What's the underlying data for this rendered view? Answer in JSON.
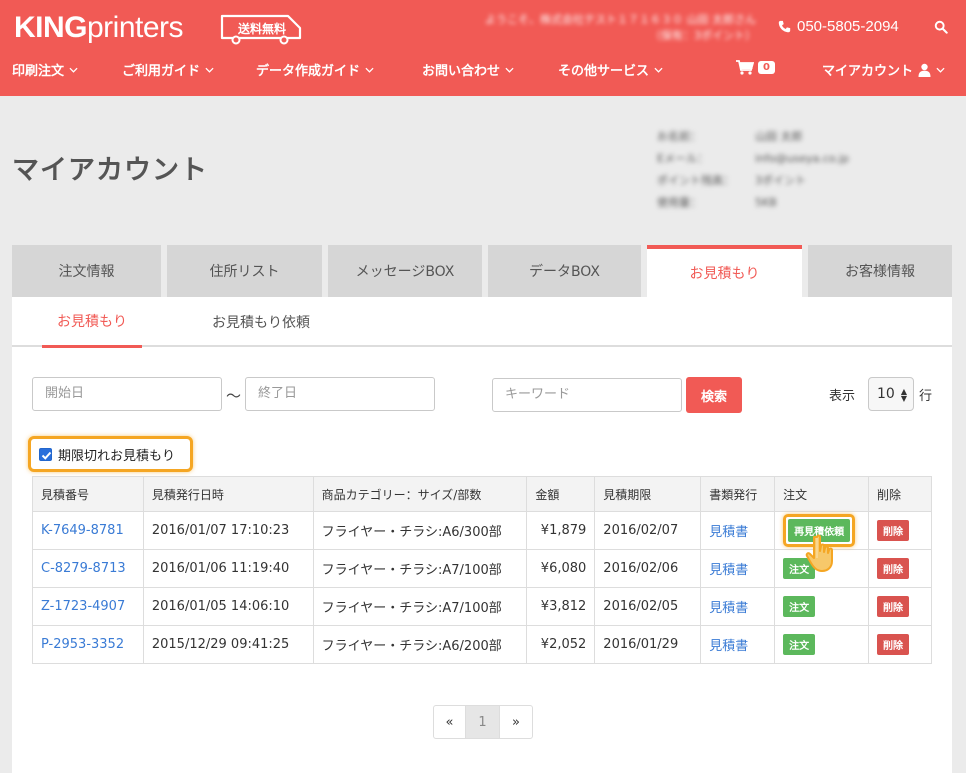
{
  "header": {
    "logo_bold": "KING",
    "logo_thin": "printers",
    "free_shipping": "送料無料",
    "welcome_line1": "ようこそ、株式会社テスト１７１６３０ 山田 太郎さん",
    "welcome_line2": "（保有：3ポイント）",
    "phone": "050-5805-2094",
    "cart_count": "0",
    "myaccount": "マイアカウント",
    "nav": [
      "印刷注文",
      "ご利用ガイド",
      "データ作成ガイド",
      "お問い合わせ",
      "その他サービス"
    ]
  },
  "page": {
    "title": "マイアカウント",
    "user_info": [
      {
        "k": "お名前：",
        "v": "山田 太郎"
      },
      {
        "k": "Eメール：",
        "v": "info@useya.co.jp"
      },
      {
        "k": "ポイント残高：",
        "v": "3ポイント"
      },
      {
        "k": "使用量：",
        "v": "5KB"
      }
    ]
  },
  "tabs": [
    "注文情報",
    "住所リスト",
    "メッセージBOX",
    "データBOX",
    "お見積もり",
    "お客様情報"
  ],
  "subtabs": [
    "お見積もり",
    "お見積もり依頼"
  ],
  "filters": {
    "start_placeholder": "開始日",
    "tilde": "〜",
    "end_placeholder": "終了日",
    "keyword_placeholder": "キーワード",
    "search_label": "検索",
    "show_label": "表示",
    "show_value": "10",
    "row_label": "行",
    "expired_label": "期限切れお見積もり"
  },
  "table": {
    "headers": [
      "見積番号",
      "見積発行日時",
      "商品カテゴリー：サイズ/部数",
      "金額",
      "見積期限",
      "書類発行",
      "注文",
      "削除"
    ],
    "rows": [
      {
        "id": "K-7649-8781",
        "date": "2016/01/07 17:10:23",
        "product": "フライヤー・チラシ:A6/300部",
        "price": "¥1,879",
        "expiry": "2016/02/07",
        "doc": "見積書",
        "order": "再見積依頼",
        "del": "削除"
      },
      {
        "id": "C-8279-8713",
        "date": "2016/01/06 11:19:40",
        "product": "フライヤー・チラシ:A7/100部",
        "price": "¥6,080",
        "expiry": "2016/02/06",
        "doc": "見積書",
        "order": "注文",
        "del": "削除"
      },
      {
        "id": "Z-1723-4907",
        "date": "2016/01/05 14:06:10",
        "product": "フライヤー・チラシ:A7/100部",
        "price": "¥3,812",
        "expiry": "2016/02/05",
        "doc": "見積書",
        "order": "注文",
        "del": "削除"
      },
      {
        "id": "P-2953-3352",
        "date": "2015/12/29 09:41:25",
        "product": "フライヤー・チラシ:A6/200部",
        "price": "¥2,052",
        "expiry": "2016/01/29",
        "doc": "見積書",
        "order": "注文",
        "del": "削除"
      }
    ]
  },
  "pagination": {
    "prev": "«",
    "current": "1",
    "next": "»"
  },
  "colors": {
    "brand": "#f15a55",
    "highlight": "#f5a623",
    "order_green": "#5cb85c",
    "delete_red": "#d9534f",
    "link_blue": "#3a7bd5"
  }
}
